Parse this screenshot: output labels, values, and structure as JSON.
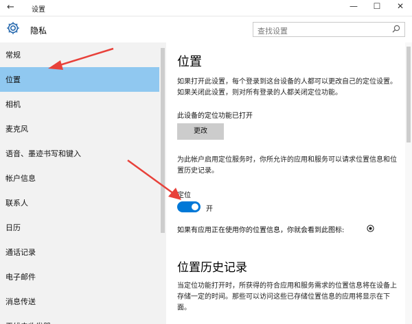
{
  "window": {
    "back": "←",
    "title": "设置",
    "minimize": "—",
    "maximize": "☐",
    "close": "✕"
  },
  "header": {
    "title": "隐私",
    "search_placeholder": "查找设置"
  },
  "sidebar": {
    "items": [
      {
        "label": "常规",
        "selected": false
      },
      {
        "label": "位置",
        "selected": true
      },
      {
        "label": "相机",
        "selected": false
      },
      {
        "label": "麦克风",
        "selected": false
      },
      {
        "label": "语音、墨迹书写和键入",
        "selected": false
      },
      {
        "label": "帐户信息",
        "selected": false
      },
      {
        "label": "联系人",
        "selected": false
      },
      {
        "label": "日历",
        "selected": false
      },
      {
        "label": "通话记录",
        "selected": false
      },
      {
        "label": "电子邮件",
        "selected": false
      },
      {
        "label": "消息传送",
        "selected": false
      },
      {
        "label": "无线电收发器",
        "selected": false
      }
    ]
  },
  "main": {
    "title": "位置",
    "intro": "如果打开此设置，每个登录到这台设备的人都可以更改自己的定位设置。如果关闭此设置，则对所有登录的人都关闭定位功能。",
    "device_status": "此设备的定位功能已打开",
    "change_button": "更改",
    "account_desc": "为此帐户启用定位服务时，你所允许的应用和服务可以请求位置信息和位置历史记录。",
    "location_label": "定位",
    "toggle": {
      "state": "开",
      "on": true
    },
    "icon_note": "如果有应用正在使用你的位置信息，你就会看到此图标:",
    "history_title": "位置历史记录",
    "history_desc": "当定位功能打开时，所获得的符合应用和服务需求的位置信息将在设备上存储一定的时间。那些可以访问这些已存储位置信息的应用将显示在下面。"
  },
  "colors": {
    "accent": "#0078d7",
    "selected_bg": "#90c8f0",
    "sidebar_bg": "#f2f2f2",
    "annotation_arrow": "#e8413a"
  }
}
